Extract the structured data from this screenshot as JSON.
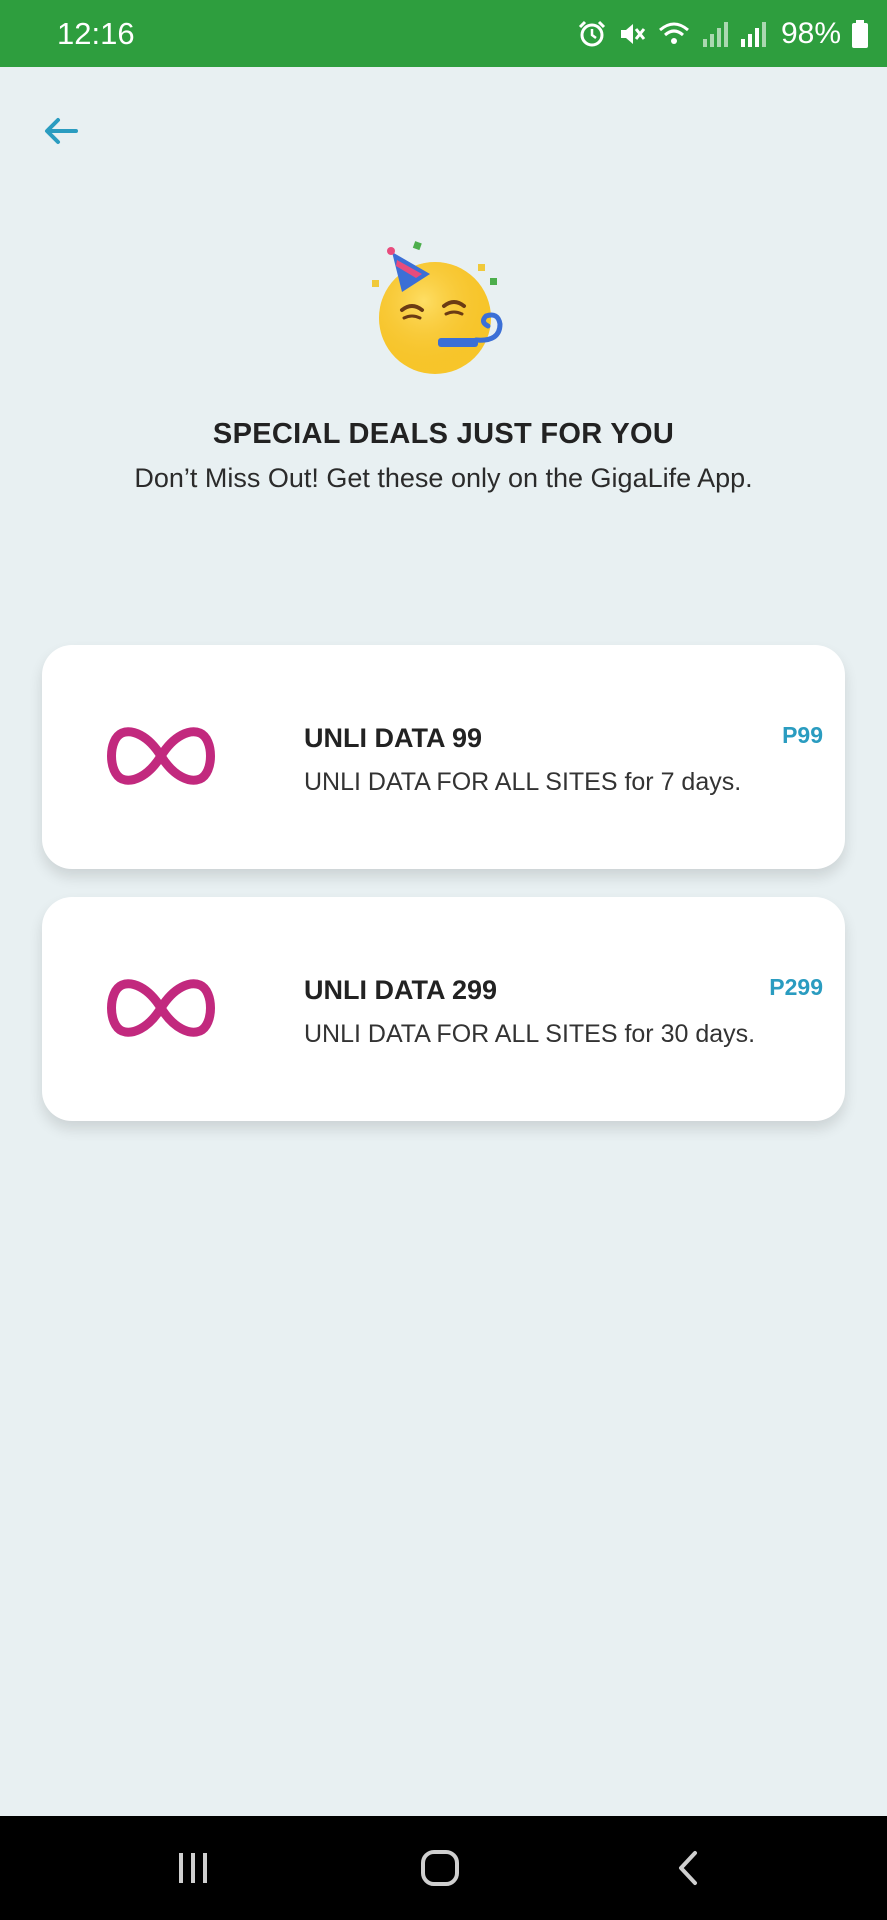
{
  "status_bar": {
    "time": "12:16",
    "battery": "98%",
    "icons": [
      "alarm-icon",
      "mute-icon",
      "wifi-icon",
      "signal-icon",
      "signal-icon",
      "battery-icon"
    ]
  },
  "header": {
    "back_icon": "arrow-left-icon",
    "emoji": "party-face-icon"
  },
  "promo": {
    "title": "SPECIAL DEALS JUST FOR YOU",
    "subtitle": "Don’t Miss Out! Get these only on the GigaLife App."
  },
  "deals": [
    {
      "icon": "infinity-icon",
      "name": "UNLI DATA 99",
      "description": "UNLI DATA FOR ALL SITES for 7 days.",
      "price": "P99"
    },
    {
      "icon": "infinity-icon",
      "name": "UNLI DATA 299",
      "description": "UNLI DATA FOR ALL SITES for 30 days.",
      "price": "P299"
    }
  ],
  "nav": {
    "icons": [
      "recent-apps-icon",
      "home-icon",
      "back-icon"
    ]
  },
  "colors": {
    "status_bar": "#2e9e3e",
    "background": "#e8f0f2",
    "accent": "#2a9cc0",
    "infinity": "#c2297e"
  }
}
